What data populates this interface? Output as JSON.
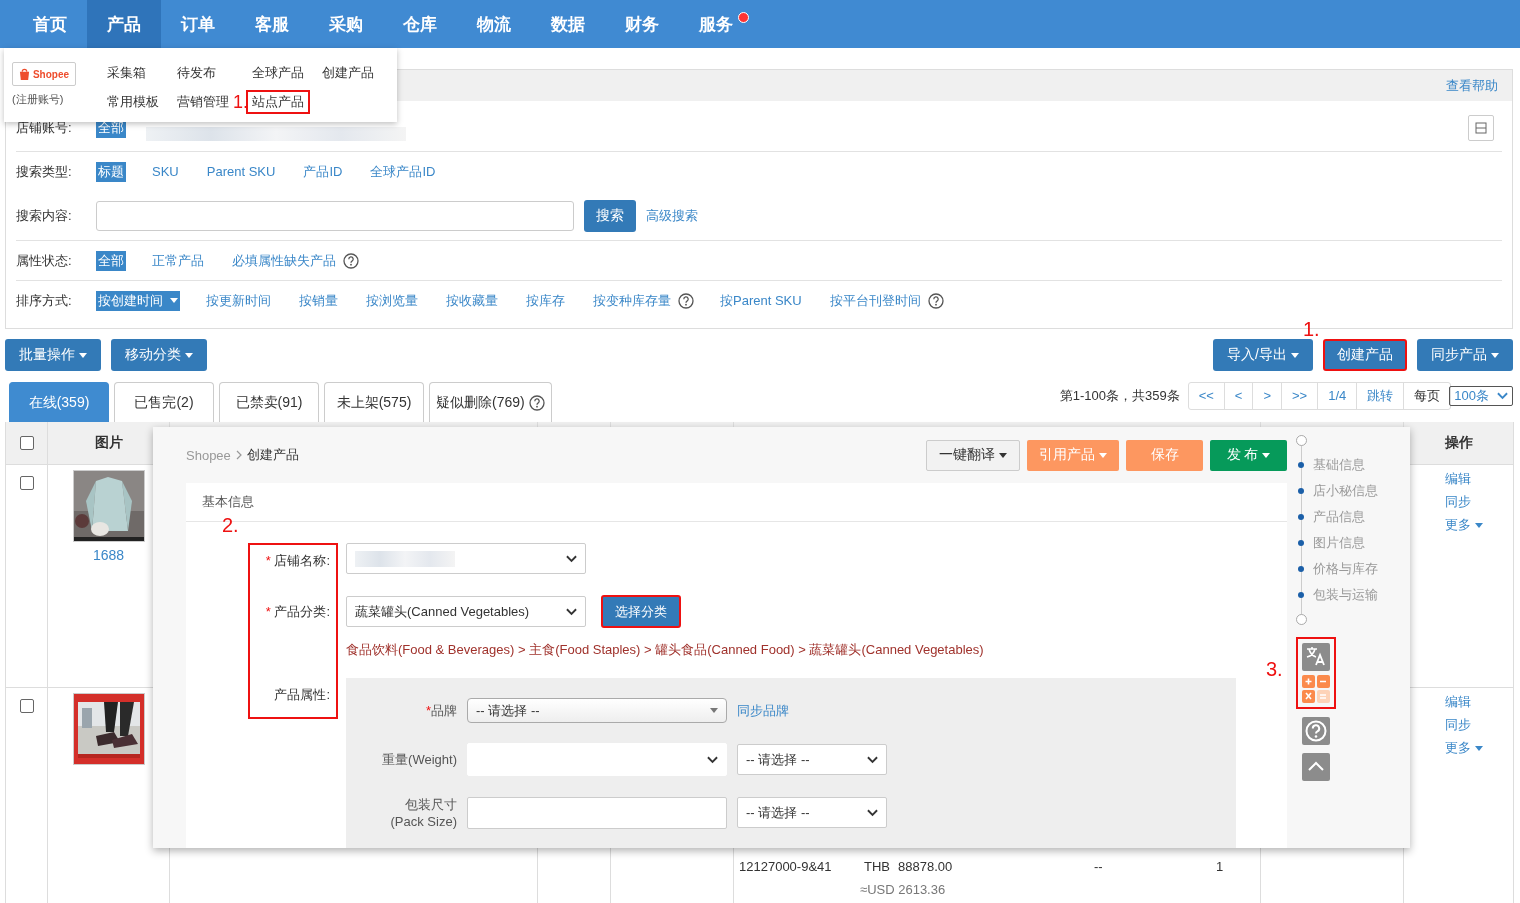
{
  "nav": {
    "items": [
      {
        "label": "首页",
        "selected": false,
        "badge": false
      },
      {
        "label": "产品",
        "selected": true,
        "badge": false
      },
      {
        "label": "订单",
        "selected": false,
        "badge": false
      },
      {
        "label": "客服",
        "selected": false,
        "badge": false
      },
      {
        "label": "采购",
        "selected": false,
        "badge": false
      },
      {
        "label": "仓库",
        "selected": false,
        "badge": false
      },
      {
        "label": "物流",
        "selected": false,
        "badge": false
      },
      {
        "label": "数据",
        "selected": false,
        "badge": false
      },
      {
        "label": "财务",
        "selected": false,
        "badge": false
      },
      {
        "label": "服务",
        "selected": false,
        "badge": true
      }
    ]
  },
  "product_menu": {
    "store": {
      "logo": "Shopee",
      "note": "(注册账号)"
    },
    "annotation": "1.",
    "links": [
      {
        "label": "采集箱",
        "highlighted": false
      },
      {
        "label": "待发布",
        "highlighted": false
      },
      {
        "label": "全球产品",
        "highlighted": false
      },
      {
        "label": "创建产品",
        "highlighted": false
      },
      {
        "label": "常用模板",
        "highlighted": false
      },
      {
        "label": "营销管理",
        "highlighted": false
      },
      {
        "label": "站点产品",
        "highlighted": true
      }
    ]
  },
  "filters": {
    "help_link": "查看帮助",
    "rows": [
      {
        "kind": "options",
        "label": "店铺账号:",
        "toggle": true,
        "options": [
          {
            "label": "全部",
            "selected": true
          }
        ]
      },
      {
        "kind": "options",
        "label": "搜索类型:",
        "options": [
          {
            "label": "标题",
            "selected": true
          },
          {
            "label": "SKU",
            "selected": false
          },
          {
            "label": "Parent SKU",
            "selected": false
          },
          {
            "label": "产品ID",
            "selected": false
          },
          {
            "label": "全球产品ID",
            "selected": false
          }
        ]
      },
      {
        "kind": "search",
        "label": "搜索内容:",
        "button": "搜索",
        "link": "高级搜索"
      },
      {
        "kind": "options",
        "label": "属性状态:",
        "options": [
          {
            "label": "全部",
            "selected": true
          },
          {
            "label": "正常产品",
            "selected": false
          },
          {
            "label": "必填属性缺失产品",
            "selected": false,
            "help": true
          }
        ]
      },
      {
        "kind": "options",
        "label": "排序方式:",
        "options": [
          {
            "label": "按创建时间",
            "selected": true,
            "dropdown": true
          },
          {
            "label": "按更新时间",
            "selected": false
          },
          {
            "label": "按销量",
            "selected": false
          },
          {
            "label": "按浏览量",
            "selected": false
          },
          {
            "label": "按收藏量",
            "selected": false
          },
          {
            "label": "按库存",
            "selected": false
          },
          {
            "label": "按变种库存量",
            "selected": false,
            "help": true
          },
          {
            "label": "按Parent SKU",
            "selected": false
          },
          {
            "label": "按平台刊登时间",
            "selected": false,
            "help": true
          }
        ]
      }
    ]
  },
  "toolbar": {
    "left": [
      {
        "label": "批量操作",
        "dropdown": true,
        "highlighted": false
      },
      {
        "label": "移动分类",
        "dropdown": true,
        "highlighted": false
      }
    ],
    "annotation": "1.",
    "right": [
      {
        "label": "导入/导出",
        "dropdown": true,
        "highlighted": false
      },
      {
        "label": "创建产品",
        "dropdown": false,
        "highlighted": true
      },
      {
        "label": "同步产品",
        "dropdown": true,
        "highlighted": false
      }
    ]
  },
  "status_tabs": [
    {
      "label": "在线(359)",
      "selected": true
    },
    {
      "label": "已售完(2)",
      "selected": false
    },
    {
      "label": "已禁卖(91)",
      "selected": false
    },
    {
      "label": "未上架(575)",
      "selected": false
    },
    {
      "label": "疑似删除(769)",
      "selected": false,
      "help": true
    }
  ],
  "pagination": {
    "summary": "第1-100条，共359条",
    "buttons": [
      "<<",
      "<",
      ">",
      ">>",
      "1/4",
      "跳转"
    ],
    "per_page_label": "每页",
    "per_page": "100条"
  },
  "table": {
    "header_checked": false,
    "columns": {
      "image": "图片",
      "actions": "操作"
    },
    "rows": [
      {
        "checked": false,
        "image": {
          "kind": "picture"
        },
        "source": "1688",
        "actions": [
          {
            "label": "编辑",
            "dropdown": false
          },
          {
            "label": "同步",
            "dropdown": false
          },
          {
            "label": "更多",
            "dropdown": true
          }
        ]
      },
      {
        "checked": false,
        "image": {
          "kind": "picture"
        },
        "actions": [
          {
            "label": "编辑",
            "dropdown": false
          },
          {
            "label": "同步",
            "dropdown": false
          },
          {
            "label": "更多",
            "dropdown": true
          }
        ],
        "variant": {
          "sku": "12127000-9&41",
          "currency": "THB",
          "price": "88878.00",
          "converted": "≈USD 2613.36",
          "column_3": "--",
          "column_4": "1"
        }
      }
    ]
  },
  "editor": {
    "breadcrumb": [
      "Shopee",
      "创建产品"
    ],
    "actions": [
      {
        "label": "一键翻译",
        "kind": "default",
        "dropdown": true
      },
      {
        "label": "引用产品",
        "kind": "orange",
        "dropdown": true
      },
      {
        "label": "保存",
        "kind": "orange",
        "dropdown": false
      },
      {
        "label": "发 布",
        "kind": "green",
        "dropdown": true
      }
    ],
    "section": {
      "title": "基本信息",
      "annotation": "2.",
      "labels_highlighted": true,
      "fields": [
        {
          "kind": "select",
          "label": "店铺名称:",
          "marker": "*"
        },
        {
          "kind": "category",
          "label": "产品分类:",
          "marker": "*",
          "value": "蔬菜罐头(Canned Vegetables)",
          "button": {
            "label": "选择分类",
            "highlighted": true
          },
          "path": "食品饮料(Food & Beverages) > 主食(Food Staples) > 罐头食品(Canned Food) > 蔬菜罐头(Canned Vegetables)"
        },
        {
          "kind": "attributes",
          "label": "产品属性:",
          "attributes": [
            {
              "kind": "brand",
              "label": "品牌",
              "marker": "*",
              "value": "-- 请选择 --",
              "link": "同步品牌"
            },
            {
              "kind": "select_unit",
              "label": "重量(Weight)",
              "unit": "-- 请选择 --"
            },
            {
              "kind": "input_unit",
              "label": "包装尺寸(Pack Size)",
              "unit": "-- 请选择 --"
            }
          ]
        }
      ]
    },
    "sections": [
      "基础信息",
      "店小秘信息",
      "产品信息",
      "图片信息",
      "价格与库存",
      "包装与运输"
    ],
    "tools": {
      "annotation": "3.",
      "groups": [
        {
          "highlighted": true,
          "items": [
            {
              "kind": "translate"
            },
            {
              "kind": "calculator"
            }
          ]
        },
        {
          "highlighted": false,
          "items": [
            {
              "kind": "help"
            },
            {
              "kind": "top"
            }
          ]
        }
      ]
    }
  }
}
